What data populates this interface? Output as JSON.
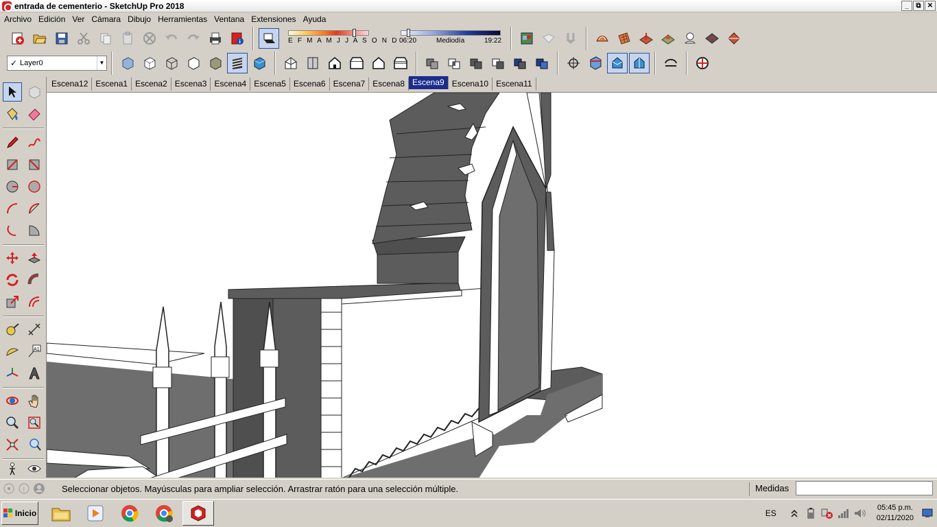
{
  "window": {
    "title": "entrada de cementerio - SketchUp Pro 2018",
    "controls": [
      "_",
      "⧉",
      "✕"
    ]
  },
  "menu": [
    "Archivo",
    "Edición",
    "Ver",
    "Cámara",
    "Dibujo",
    "Herramientas",
    "Ventana",
    "Extensiones",
    "Ayuda"
  ],
  "toolbar1": {
    "standard": [
      "new-icon",
      "open-icon",
      "save-icon",
      "cut-icon",
      "copy-icon",
      "paste-icon",
      "erase-icon",
      "undo-icon",
      "redo-icon",
      "print-icon",
      "model-info-icon"
    ],
    "shadows": {
      "toggle_icon": "shadow-toggle-icon",
      "months_label": "E F M A M J J A S O N D",
      "time_start": "06:20",
      "time_mid": "Mediodía",
      "time_end": "19:22"
    },
    "location": [
      "geo-location-icon",
      "photo-texture-icon",
      "terrain-icon"
    ],
    "sandbox": [
      "sandbox-contours-icon",
      "sandbox-scratch-icon",
      "smoove-icon",
      "stamp-icon",
      "drape-icon",
      "add-detail-icon",
      "flip-edge-icon"
    ]
  },
  "toolbar2": {
    "layer": {
      "check": "✓",
      "value": "Layer0"
    },
    "styles": [
      "xray-style-icon",
      "backedges-style-icon",
      "wireframe-style-icon",
      "hiddenline-style-icon",
      "shaded-style-icon",
      "textured-style-icon",
      "monochrome-style-icon"
    ],
    "views": [
      "iso-view-icon",
      "top-view-icon",
      "front-view-icon",
      "right-view-icon",
      "back-view-icon",
      "left-view-icon"
    ],
    "solids": [
      "outer-shell-icon",
      "intersect-icon",
      "union-icon",
      "subtract-icon",
      "trim-icon",
      "split-icon"
    ],
    "misc": [
      "position-camera-icon",
      "section-plane-icon",
      "section-display-icon",
      "section-cuts-icon",
      "follow-me-icon",
      "warehouse-icon"
    ]
  },
  "scenes": {
    "tabs": [
      "Escena12",
      "Escena1",
      "Escena2",
      "Escena3",
      "Escena4",
      "Escena5",
      "Escena6",
      "Escena7",
      "Escena8",
      "Escena9",
      "Escena10",
      "Escena11"
    ],
    "active": "Escena9"
  },
  "lefttools": [
    "select-icon",
    "component-icon",
    "paint-bucket-icon",
    "eraser-icon",
    "pencil-icon",
    "freehand-icon",
    "rectangle-icon",
    "rotated-rectangle-icon",
    "circle-icon",
    "polygon-icon",
    "arc-icon",
    "two-point-arc-icon",
    "three-point-arc-icon",
    "pie-icon",
    "move-icon",
    "push-pull-icon",
    "rotate-icon",
    "follow-me-icon",
    "scale-icon",
    "offset-icon",
    "tape-measure-icon",
    "dimension-icon",
    "protractor-icon",
    "text-icon",
    "axes-icon",
    "3d-text-icon",
    "orbit-icon",
    "pan-icon",
    "zoom-icon",
    "zoom-window-icon",
    "zoom-extents-icon",
    "previous-view-icon",
    "walk-icon",
    "look-around-icon"
  ],
  "status": {
    "text": "Seleccionar objetos. Mayúsculas para ampliar selección. Arrastrar ratón para una selección múltiple.",
    "measure_label": "Medidas",
    "measure_value": ""
  },
  "taskbar": {
    "start": "Inicio",
    "apps": [
      "explorer-icon",
      "media-player-icon",
      "chrome-icon",
      "chrome-profile-icon",
      "sketchup-icon"
    ],
    "lang": "ES",
    "time": "05:45 p.m.",
    "date": "02/11/2020"
  },
  "colors": {
    "active_scene": "#1c2c8c",
    "sketchup_red": "#d32222",
    "model_gray": "#5c5c5c",
    "shadow_gray": "#6e6e6e"
  }
}
